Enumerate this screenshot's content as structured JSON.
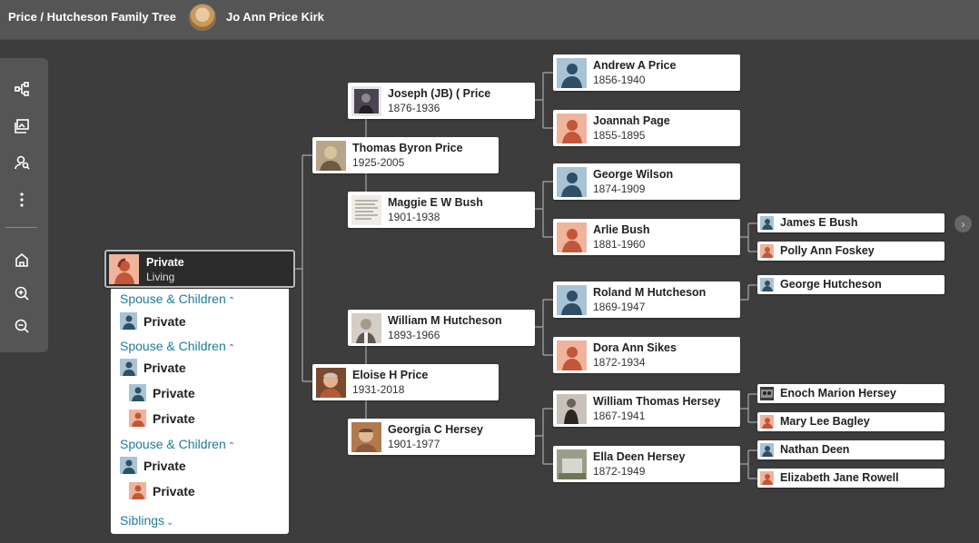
{
  "header": {
    "tree_title": "Price / Hutcheson Family Tree",
    "owner_name": "Jo Ann Price Kirk"
  },
  "toolbar": {
    "items": [
      "tree-view-icon",
      "media-gallery-icon",
      "person-search-icon",
      "more-options-icon",
      "home-icon",
      "zoom-in-icon",
      "zoom-out-icon"
    ]
  },
  "focus_person": {
    "name": "Private",
    "status": "Living"
  },
  "family_panel": {
    "spouse_children_label": "Spouse & Children",
    "siblings_label": "Siblings",
    "groups": [
      {
        "spouse": "Private",
        "children": []
      },
      {
        "spouse": "Private",
        "children": [
          "Private",
          "Private"
        ]
      },
      {
        "spouse": "Private",
        "children": [
          "Private"
        ]
      }
    ]
  },
  "parents": {
    "father": {
      "name": "Thomas Byron Price",
      "dates": "1925-2005"
    },
    "mother": {
      "name": "Eloise H Price",
      "dates": "1931-2018"
    }
  },
  "grandparents": {
    "paternal_grandfather": {
      "name": "Joseph (JB) ( Price",
      "dates": "1876-1936"
    },
    "paternal_grandmother": {
      "name": "Maggie E W Bush",
      "dates": "1901-1938"
    },
    "maternal_grandfather": {
      "name": "William M Hutcheson",
      "dates": "1893-1966"
    },
    "maternal_grandmother": {
      "name": "Georgia C Hersey",
      "dates": "1901-1977"
    }
  },
  "great_grandparents": {
    "gg1": {
      "name": "Andrew A Price",
      "dates": "1856-1940"
    },
    "gg2": {
      "name": "Joannah Page",
      "dates": "1855-1895"
    },
    "gg3": {
      "name": "George Wilson",
      "dates": "1874-1909"
    },
    "gg4": {
      "name": "Arlie Bush",
      "dates": "1881-1960"
    },
    "gg5": {
      "name": "Roland M Hutcheson",
      "dates": "1869-1947"
    },
    "gg6": {
      "name": "Dora Ann Sikes",
      "dates": "1872-1934"
    },
    "gg7": {
      "name": "William Thomas Hersey",
      "dates": "1867-1941"
    },
    "gg8": {
      "name": "Ella Deen Hersey",
      "dates": "1872-1949"
    }
  },
  "gg_grandparents": {
    "a": "James E Bush",
    "b": "Polly Ann Foskey",
    "c": "George Hutcheson",
    "d": "Enoch Marion Hersey",
    "e": "Mary Lee Bagley",
    "f": "Nathan Deen",
    "g": "Elizabeth Jane Rowell"
  },
  "colors": {
    "background": "#3d3d3d",
    "header": "#555555",
    "link": "#1e7b9a",
    "male_avatar": "#a9c3d6",
    "female_avatar": "#f0b39b"
  }
}
